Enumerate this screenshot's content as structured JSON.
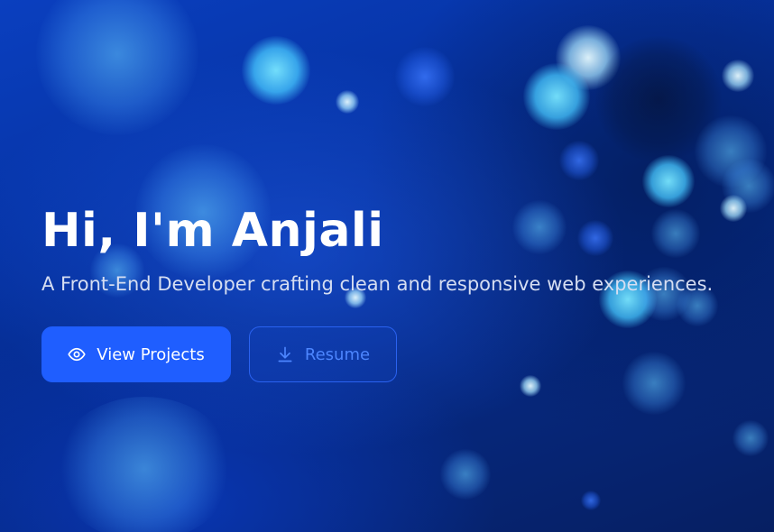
{
  "hero": {
    "title": "Hi, I'm Anjali",
    "subtitle": "A Front-End Developer crafting clean and responsive web experiences.",
    "buttons": {
      "primary": {
        "label": "View Projects",
        "icon": "eye-icon"
      },
      "secondary": {
        "label": "Resume",
        "icon": "download-icon"
      }
    }
  },
  "colors": {
    "primary_button": "#1f5eff",
    "secondary_text": "#4d86ff",
    "background": "#0634a6"
  }
}
